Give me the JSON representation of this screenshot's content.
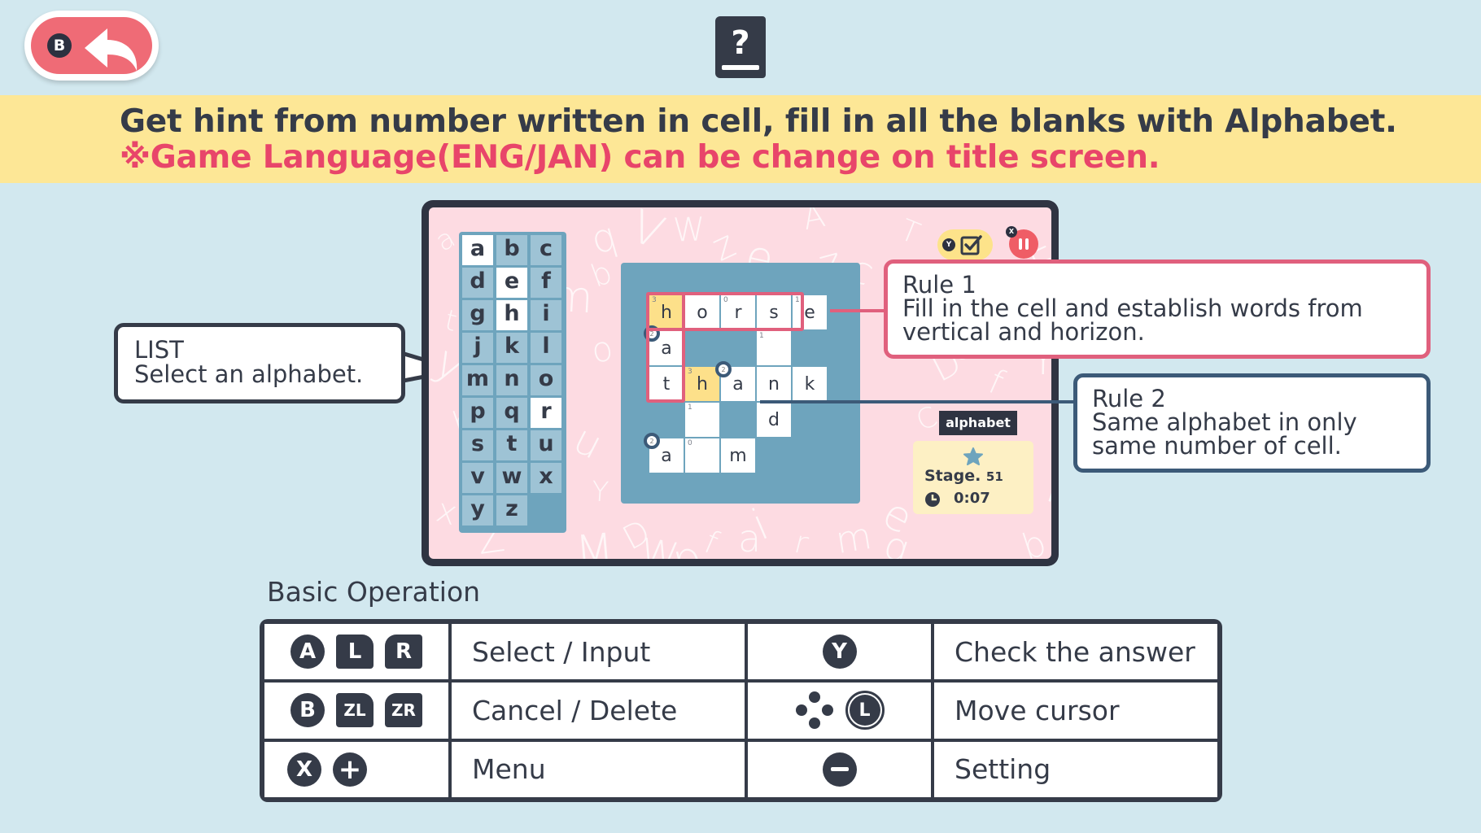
{
  "header": {
    "back_button": {
      "badge": "B",
      "icon": "back-arrow-icon"
    },
    "help_icon": "help-book-icon"
  },
  "instructions": {
    "line1": "Get hint from number written in cell, fill in all the blanks with Alphabet.",
    "line2": "※Game Language(ENG/JAN) can be change on title screen."
  },
  "colors": {
    "background": "#d2e8ef",
    "instruction_band": "#fde796",
    "warning_text": "#e8456a",
    "panel_pink": "#fddbe2",
    "grid_blue": "#6ea4bd",
    "rule1_border": "#e0607d",
    "rule2_border": "#3c5a78",
    "dark": "#353b48"
  },
  "game": {
    "alphabet_list": [
      {
        "letter": "a",
        "used": true
      },
      {
        "letter": "b",
        "used": false
      },
      {
        "letter": "c",
        "used": false
      },
      {
        "letter": "d",
        "used": false
      },
      {
        "letter": "e",
        "used": true
      },
      {
        "letter": "f",
        "used": false
      },
      {
        "letter": "g",
        "used": false
      },
      {
        "letter": "h",
        "used": true
      },
      {
        "letter": "i",
        "used": false
      },
      {
        "letter": "j",
        "used": false
      },
      {
        "letter": "k",
        "used": false
      },
      {
        "letter": "l",
        "used": false
      },
      {
        "letter": "m",
        "used": false
      },
      {
        "letter": "n",
        "used": false
      },
      {
        "letter": "o",
        "used": false
      },
      {
        "letter": "p",
        "used": false
      },
      {
        "letter": "q",
        "used": false
      },
      {
        "letter": "r",
        "used": true
      },
      {
        "letter": "s",
        "used": false
      },
      {
        "letter": "t",
        "used": false
      },
      {
        "letter": "u",
        "used": false
      },
      {
        "letter": "v",
        "used": false
      },
      {
        "letter": "w",
        "used": false
      },
      {
        "letter": "x",
        "used": false
      },
      {
        "letter": "y",
        "used": false
      },
      {
        "letter": "z",
        "used": false
      }
    ],
    "grid_cells": [
      {
        "row": 0,
        "col": 0,
        "letter": "h",
        "hint": "3",
        "highlight": true,
        "circle": false
      },
      {
        "row": 0,
        "col": 1,
        "letter": "o",
        "hint": "",
        "highlight": false,
        "circle": false
      },
      {
        "row": 0,
        "col": 2,
        "letter": "r",
        "hint": "0",
        "highlight": false,
        "circle": false
      },
      {
        "row": 0,
        "col": 3,
        "letter": "s",
        "hint": "",
        "highlight": false,
        "circle": false
      },
      {
        "row": 0,
        "col": 4,
        "letter": "e",
        "hint": "1",
        "highlight": false,
        "circle": false
      },
      {
        "row": 1,
        "col": 0,
        "letter": "a",
        "hint": "2",
        "highlight": false,
        "circle": true
      },
      {
        "row": 1,
        "col": 3,
        "letter": "",
        "hint": "1",
        "highlight": false,
        "circle": false
      },
      {
        "row": 2,
        "col": 0,
        "letter": "t",
        "hint": "",
        "highlight": false,
        "circle": false
      },
      {
        "row": 2,
        "col": 1,
        "letter": "h",
        "hint": "3",
        "highlight": true,
        "circle": false
      },
      {
        "row": 2,
        "col": 2,
        "letter": "a",
        "hint": "2",
        "highlight": false,
        "circle": true
      },
      {
        "row": 2,
        "col": 3,
        "letter": "n",
        "hint": "",
        "highlight": false,
        "circle": false
      },
      {
        "row": 2,
        "col": 4,
        "letter": "k",
        "hint": "",
        "highlight": false,
        "circle": false
      },
      {
        "row": 3,
        "col": 1,
        "letter": "",
        "hint": "1",
        "highlight": false,
        "circle": false
      },
      {
        "row": 3,
        "col": 3,
        "letter": "d",
        "hint": "",
        "highlight": false,
        "circle": false
      },
      {
        "row": 4,
        "col": 0,
        "letter": "a",
        "hint": "2",
        "highlight": false,
        "circle": true
      },
      {
        "row": 4,
        "col": 1,
        "letter": "",
        "hint": "0",
        "highlight": false,
        "circle": false
      },
      {
        "row": 4,
        "col": 2,
        "letter": "m",
        "hint": "",
        "highlight": false,
        "circle": false
      }
    ],
    "check_button": {
      "badge": "Y",
      "icon": "checkbox-check-icon"
    },
    "pause_button": {
      "badge": "X",
      "icon": "pause-icon"
    },
    "mode_tag": "alphabet",
    "stage": {
      "label": "Stage.",
      "number": "51",
      "time": "0:07"
    },
    "background_letters": [
      "a",
      "K",
      "q",
      "V",
      "W",
      "z",
      "e",
      "A",
      "c",
      "m",
      "b",
      "v",
      "w",
      "p",
      "j",
      "z",
      "T",
      "e",
      "E",
      "t",
      "o",
      "u",
      "Y",
      "h",
      "g",
      "M",
      "D",
      "W",
      "p",
      "f",
      "a",
      "i",
      "r",
      "m",
      "e",
      "W",
      "b",
      "N",
      "a",
      "D",
      "6",
      "V",
      "f",
      "Y",
      "C",
      "x",
      "Z",
      "y",
      "h"
    ]
  },
  "callouts": {
    "list": {
      "title": "LIST",
      "text": "Select an alphabet."
    },
    "rule1": {
      "title": "Rule 1",
      "text": "Fill in the cell and establish words from vertical and horizon."
    },
    "rule2": {
      "title": "Rule 2",
      "text": "Same alphabet in only same number of cell."
    }
  },
  "basic_operation": {
    "title": "Basic Operation",
    "rows": [
      {
        "left_buttons": [
          "A",
          "L",
          "R"
        ],
        "left_action": "Select / Input",
        "right_buttons": [
          "Y"
        ],
        "right_action": "Check the answer"
      },
      {
        "left_buttons": [
          "B",
          "ZL",
          "ZR"
        ],
        "left_action": "Cancel / Delete",
        "right_buttons": [
          "D-Pad",
          "L-Stick"
        ],
        "right_action": "Move cursor"
      },
      {
        "left_buttons": [
          "X",
          "+"
        ],
        "left_action": "Menu",
        "right_buttons": [
          "−"
        ],
        "right_action": "Setting"
      }
    ]
  }
}
